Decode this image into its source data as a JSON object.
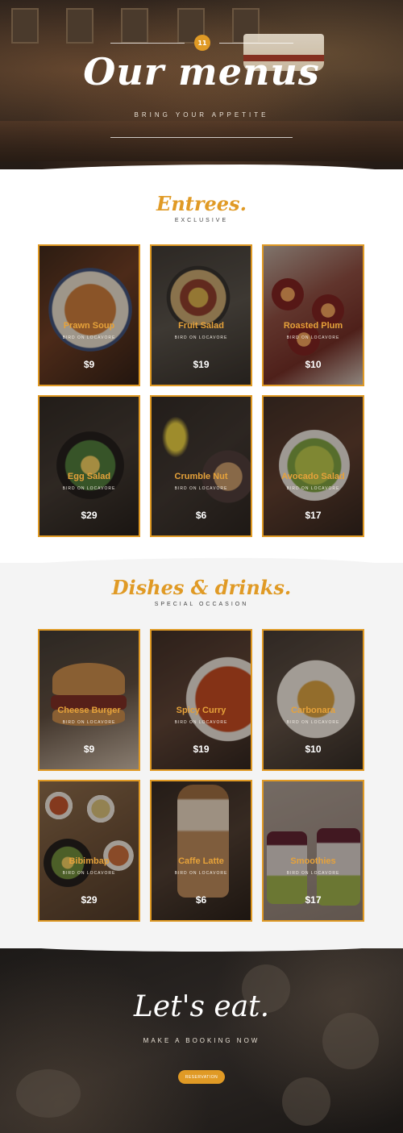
{
  "hero": {
    "badge": "11",
    "title": "Our menus",
    "subtitle": "BRING YOUR APPETITE"
  },
  "entrees": {
    "title": "Entrees.",
    "subtitle": "EXCLUSIVE",
    "items": [
      {
        "name": "Prawn Soup",
        "tag": "BIRD ON LOCAVORE",
        "price": "$9"
      },
      {
        "name": "Fruit Salad",
        "tag": "BIRD ON LOCAVORE",
        "price": "$19"
      },
      {
        "name": "Roasted Plum",
        "tag": "BIRD ON LOCAVORE",
        "price": "$10"
      },
      {
        "name": "Egg Salad",
        "tag": "BIRD ON LOCAVORE",
        "price": "$29"
      },
      {
        "name": "Crumble Nut",
        "tag": "BIRD ON LOCAVORE",
        "price": "$6"
      },
      {
        "name": "Avocado Salad",
        "tag": "BIRD ON LOCAVORE",
        "price": "$17"
      }
    ]
  },
  "dishes": {
    "title": "Dishes & drinks.",
    "subtitle": "SPECIAL OCCASION",
    "items": [
      {
        "name": "Cheese Burger",
        "tag": "BIRD ON LOCAVORE",
        "price": "$9"
      },
      {
        "name": "Spicy Curry",
        "tag": "BIRD ON LOCAVORE",
        "price": "$19"
      },
      {
        "name": "Carbonara",
        "tag": "BIRD ON LOCAVORE",
        "price": "$10"
      },
      {
        "name": "Bibimbap",
        "tag": "BIRD ON LOCAVORE",
        "price": "$29"
      },
      {
        "name": "Caffe Latte",
        "tag": "BIRD ON LOCAVORE",
        "price": "$6"
      },
      {
        "name": "Smoothies",
        "tag": "BIRD ON LOCAVORE",
        "price": "$17"
      }
    ]
  },
  "footer": {
    "title": "Let's eat.",
    "subtitle": "MAKE A BOOKING NOW",
    "button_label": "RESERVATION"
  },
  "colors": {
    "accent": "#e09a25",
    "card_name": "#e6a23a"
  }
}
